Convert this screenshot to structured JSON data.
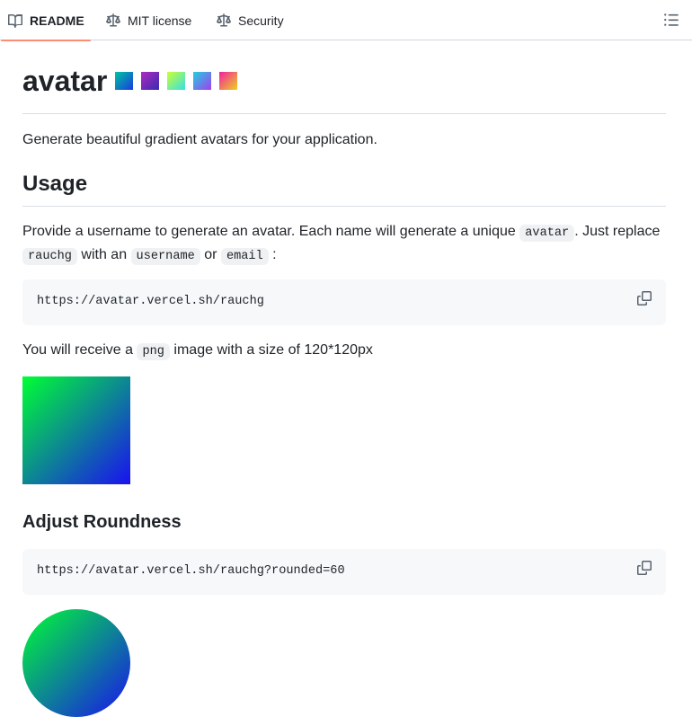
{
  "tabs": {
    "readme": "README",
    "license": "MIT license",
    "security": "Security"
  },
  "readme": {
    "title": "avatar",
    "badges": [
      {
        "from": "#00c6a0",
        "to": "#1a3ae0"
      },
      {
        "from": "#b02ac0",
        "to": "#3a2ab0"
      },
      {
        "from": "#ccff33",
        "to": "#33e0e8"
      },
      {
        "from": "#22d0e0",
        "to": "#a040f0"
      },
      {
        "from": "#f020a0",
        "to": "#f0d020"
      }
    ],
    "intro": "Generate beautiful gradient avatars for your application.",
    "usage_heading": "Usage",
    "usage_text": {
      "part1": "Provide a username to generate an avatar. Each name will generate a unique ",
      "code1": "avatar",
      "part2": ". Just replace ",
      "code2": "rauchg",
      "part3": " with an ",
      "code3": "username",
      "part4": " or ",
      "code4": "email",
      "part5": " :"
    },
    "code_url": "https://avatar.vercel.sh/rauchg",
    "receive_text": {
      "part1": "You will receive a ",
      "code": "png",
      "part2": " image with a size of 120*120px"
    },
    "roundness_heading": "Adjust Roundness",
    "code_rounded": "https://avatar.vercel.sh/rauchg?rounded=60"
  },
  "colors": {
    "tab_underline": "#fd8c73",
    "avatar_from": "#00ff33",
    "avatar_to": "#1a10f0"
  }
}
